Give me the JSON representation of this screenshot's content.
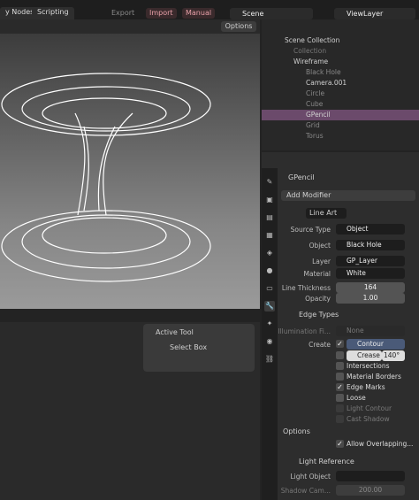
{
  "topbar": {
    "tabs": [
      "y Nodes",
      "Scripting"
    ],
    "export": "Export",
    "import": "Import",
    "manual": "Manual",
    "scene": "Scene",
    "viewlayer": "ViewLayer"
  },
  "viewport": {
    "options": "Options"
  },
  "outliner": {
    "items": [
      {
        "label": "Scene Collection"
      },
      {
        "label": "Collection"
      },
      {
        "label": "Wireframe"
      },
      {
        "label": "Black Hole"
      },
      {
        "label": "Camera.001"
      },
      {
        "label": "Circle"
      },
      {
        "label": "Cube"
      },
      {
        "label": "GPencil"
      },
      {
        "label": "Grid"
      },
      {
        "label": "Torus"
      }
    ]
  },
  "properties": {
    "object_name": "GPencil",
    "add_modifier": "Add Modifier",
    "modifier_name": "Line Art",
    "source_type_label": "Source Type",
    "source_type": "Object",
    "object_label": "Object",
    "object": "Black Hole",
    "layer_label": "Layer",
    "layer": "GP_Layer",
    "material_label": "Material",
    "material": "White",
    "thickness_label": "Line Thickness",
    "thickness": "164",
    "opacity_label": "Opacity",
    "opacity": "1.00",
    "edge_types": "Edge Types",
    "illum_label": "Illumination Fi...",
    "illum": "None",
    "create_label": "Create",
    "contour": "Contour",
    "crease": "Crease T",
    "crease_val": "140°",
    "intersections": "Intersections",
    "material_borders": "Material Borders",
    "edge_marks": "Edge Marks",
    "loose": "Loose",
    "light_contour": "Light Contour",
    "cast_shadow": "Cast Shadow",
    "options": "Options",
    "allow_overlap": "Allow Overlapping...",
    "light_ref": "Light Reference",
    "light_obj_label": "Light Object",
    "shadow_cam_label": "Shadow Cam...",
    "shadow_cam": "200.00"
  },
  "tool": {
    "title": "Active Tool",
    "select": "Select Box"
  }
}
